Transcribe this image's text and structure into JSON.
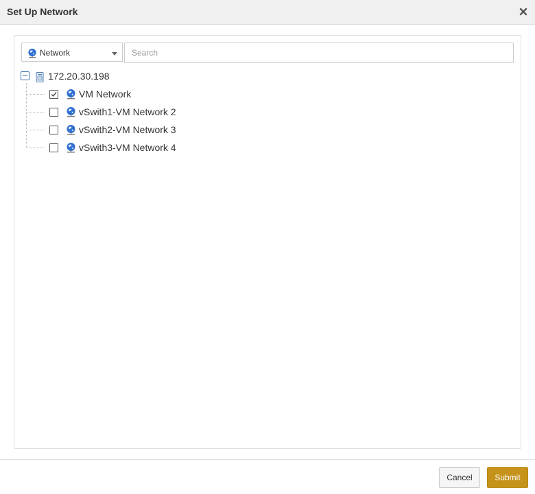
{
  "dialog": {
    "title": "Set Up Network",
    "close_icon": "close-icon"
  },
  "filter": {
    "type_selected": "Network",
    "type_icon": "network-globe-icon",
    "search_placeholder": "Search",
    "search_value": ""
  },
  "tree": {
    "root": {
      "label": "172.20.30.198",
      "icon": "server-icon",
      "expanded": true
    },
    "children": [
      {
        "label": "VM Network",
        "checked": true,
        "icon": "network-globe-icon"
      },
      {
        "label": "vSwith1-VM Network 2",
        "checked": false,
        "icon": "network-globe-icon"
      },
      {
        "label": "vSwith2-VM Network 3",
        "checked": false,
        "icon": "network-globe-icon"
      },
      {
        "label": "vSwith3-VM Network 4",
        "checked": false,
        "icon": "network-globe-icon"
      }
    ]
  },
  "footer": {
    "cancel_label": "Cancel",
    "submit_label": "Submit"
  },
  "colors": {
    "header_bg": "#f0f0f0",
    "submit_bg": "#c5921a",
    "tree_toggle": "#3a73b3",
    "globe_blue": "#2f6fd0"
  }
}
